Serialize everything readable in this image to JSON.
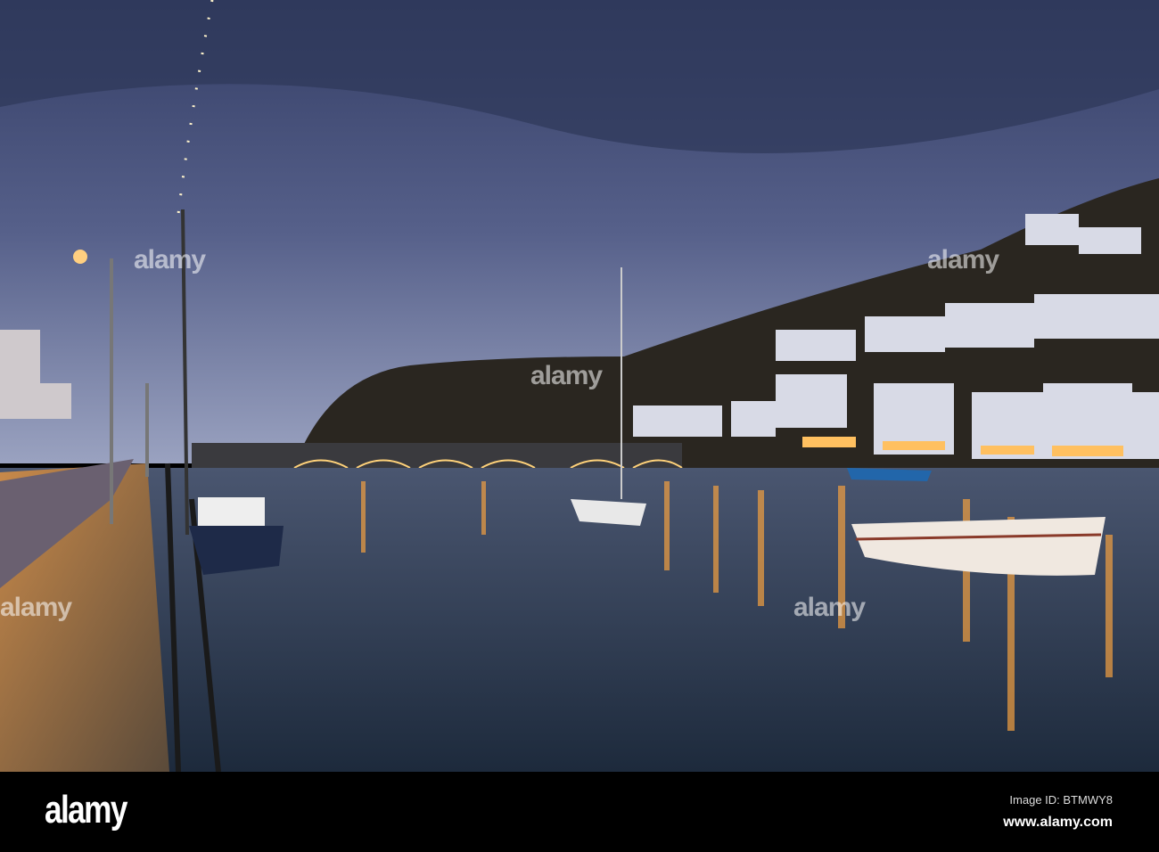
{
  "photo": {
    "subject": "harbour-at-dusk",
    "colors": {
      "sky_top": "#3b4670",
      "sky_low": "#8a94b8",
      "water": "#2c3a50",
      "lamp": "#ffb347",
      "hill": "#2a2620"
    }
  },
  "watermark": {
    "text": "alamy"
  },
  "footer": {
    "logo": "alamy",
    "image_id": "Image ID: BTMWY8",
    "url": "www.alamy.com"
  }
}
